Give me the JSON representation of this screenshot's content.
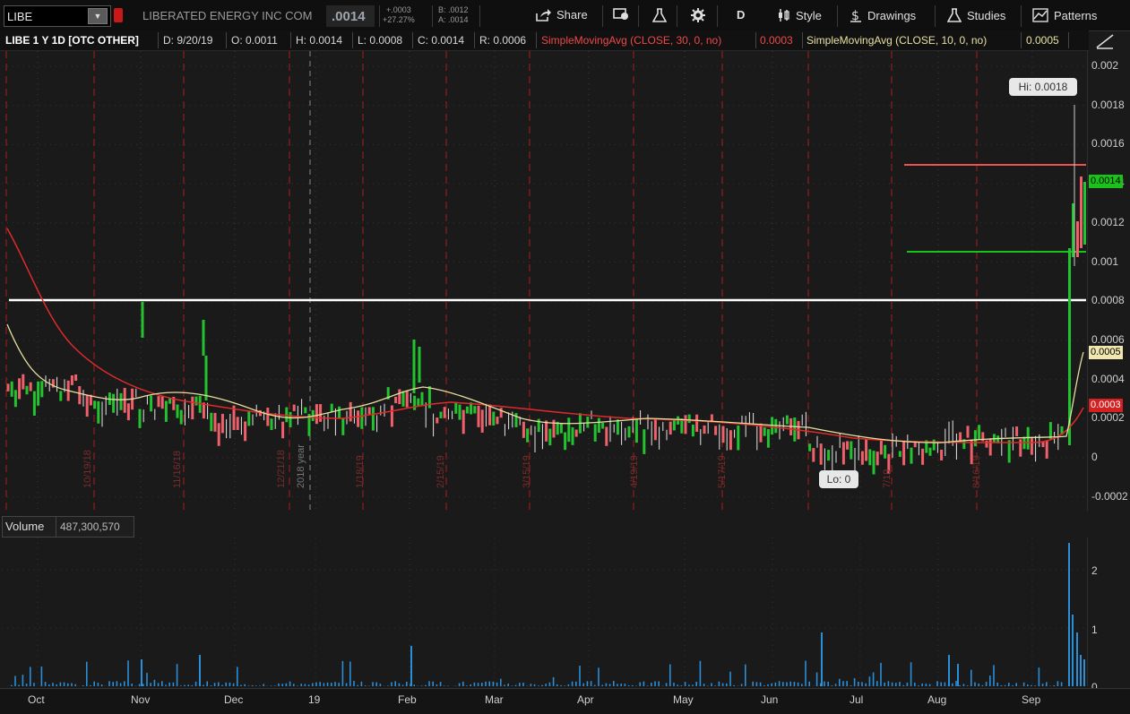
{
  "toolbar": {
    "symbol": "LIBE",
    "company": "LIBERATED ENERGY INC COM",
    "last": ".0014",
    "change": "+.0003",
    "change_pct": "+27.27%",
    "bid": "B: .0012",
    "ask": "A: .0014",
    "share_label": "Share",
    "aggregation": "D",
    "style_label": "Style",
    "drawings_label": "Drawings",
    "studies_label": "Studies",
    "patterns_label": "Patterns"
  },
  "header": {
    "title": "LIBE 1 Y 1D [OTC OTHER]",
    "date": "D: 9/20/19",
    "open": "O: 0.0011",
    "high": "H: 0.0014",
    "low": "L: 0.0008",
    "close": "C: 0.0014",
    "range": "R: 0.0006",
    "sma30_label": "SimpleMovingAvg (CLOSE, 30, 0, no)",
    "sma30_value": "0.0003",
    "sma10_label": "SimpleMovingAvg (CLOSE, 10, 0, no)",
    "sma10_value": "0.0005"
  },
  "price_axis": {
    "ticks": [
      "0.002",
      "0.0018",
      "0.0016",
      "0.0014",
      "0.0012",
      "0.001",
      "0.0008",
      "0.0006",
      "0.0004",
      "0.0002",
      "0",
      "-0.0002"
    ],
    "last_tag": "0.0014",
    "sma10_tag": "0.0005",
    "sma30_tag": "0.0003"
  },
  "annotations": {
    "hi": "Hi: 0.0018",
    "lo": "Lo: 0",
    "year_marker": "2018 year",
    "dates": [
      "10/19/18",
      "11/16/18",
      "12/21/18",
      "1/18/19",
      "2/15/19",
      "3/15/19",
      "4/19/19",
      "5/17/19",
      "7/19",
      "8/16/19"
    ]
  },
  "volume": {
    "label": "Volume",
    "value": "487,300,570",
    "ticks": [
      "2",
      "1",
      "0"
    ]
  },
  "time_axis": {
    "months": [
      "Oct",
      "Nov",
      "Dec",
      "19",
      "Feb",
      "Mar",
      "Apr",
      "May",
      "Jun",
      "Jul",
      "Aug",
      "Sep"
    ]
  },
  "colors": {
    "up": "#22c32e",
    "down": "#f0606a",
    "neutral": "#e6e6e6",
    "sma30": "#e02a2a",
    "sma10": "#e8e0a0",
    "resistance": "#f05050",
    "support": "#19c419",
    "level": "#ffffff",
    "volume": "#2a8ed8"
  },
  "chart_data": {
    "type": "candlestick",
    "ylim": [
      -0.0002,
      0.002
    ],
    "horizontal_lines": [
      {
        "value": 0.0015,
        "color": "red"
      },
      {
        "value": 0.00105,
        "color": "green"
      },
      {
        "value": 0.0008,
        "color": "white"
      }
    ],
    "hi": 0.0018,
    "lo": 0,
    "last": 0.0014,
    "sma10_last": 0.0005,
    "sma30_last": 0.0003
  }
}
